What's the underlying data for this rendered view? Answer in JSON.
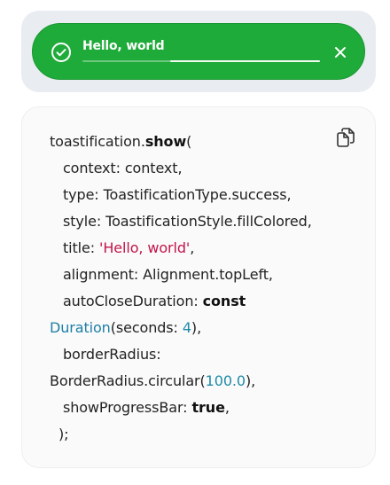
{
  "toast": {
    "title": "Hello, world",
    "progress_fraction": 0.63,
    "color": "#1fab3a",
    "icon": "check-circle-icon",
    "close_icon": "close-icon"
  },
  "code": {
    "copy_icon": "copy-icon",
    "lines": {
      "l1_obj": "toastification.",
      "l1_method": "show",
      "l1_paren": "(",
      "l2": "context: context,",
      "l3": "type: ToastificationType.success,",
      "l4": "style: ToastificationStyle.fillColored,",
      "l5_key": "title: ",
      "l5_str": "'Hello, world'",
      "l5_end": ",",
      "l6": "alignment: Alignment.topLeft,",
      "l7_key": "autoCloseDuration: ",
      "l7_kw": "const",
      "l8_cls": "Duration",
      "l8_mid": "(seconds: ",
      "l8_num": "4",
      "l8_end": "),",
      "l9": "borderRadius:",
      "l10_a": "BorderRadius.circular(",
      "l10_num": "100.0",
      "l10_end": "),",
      "l11_key": "showProgressBar: ",
      "l11_kw": "true",
      "l11_end": ",",
      "l12": ");"
    }
  }
}
